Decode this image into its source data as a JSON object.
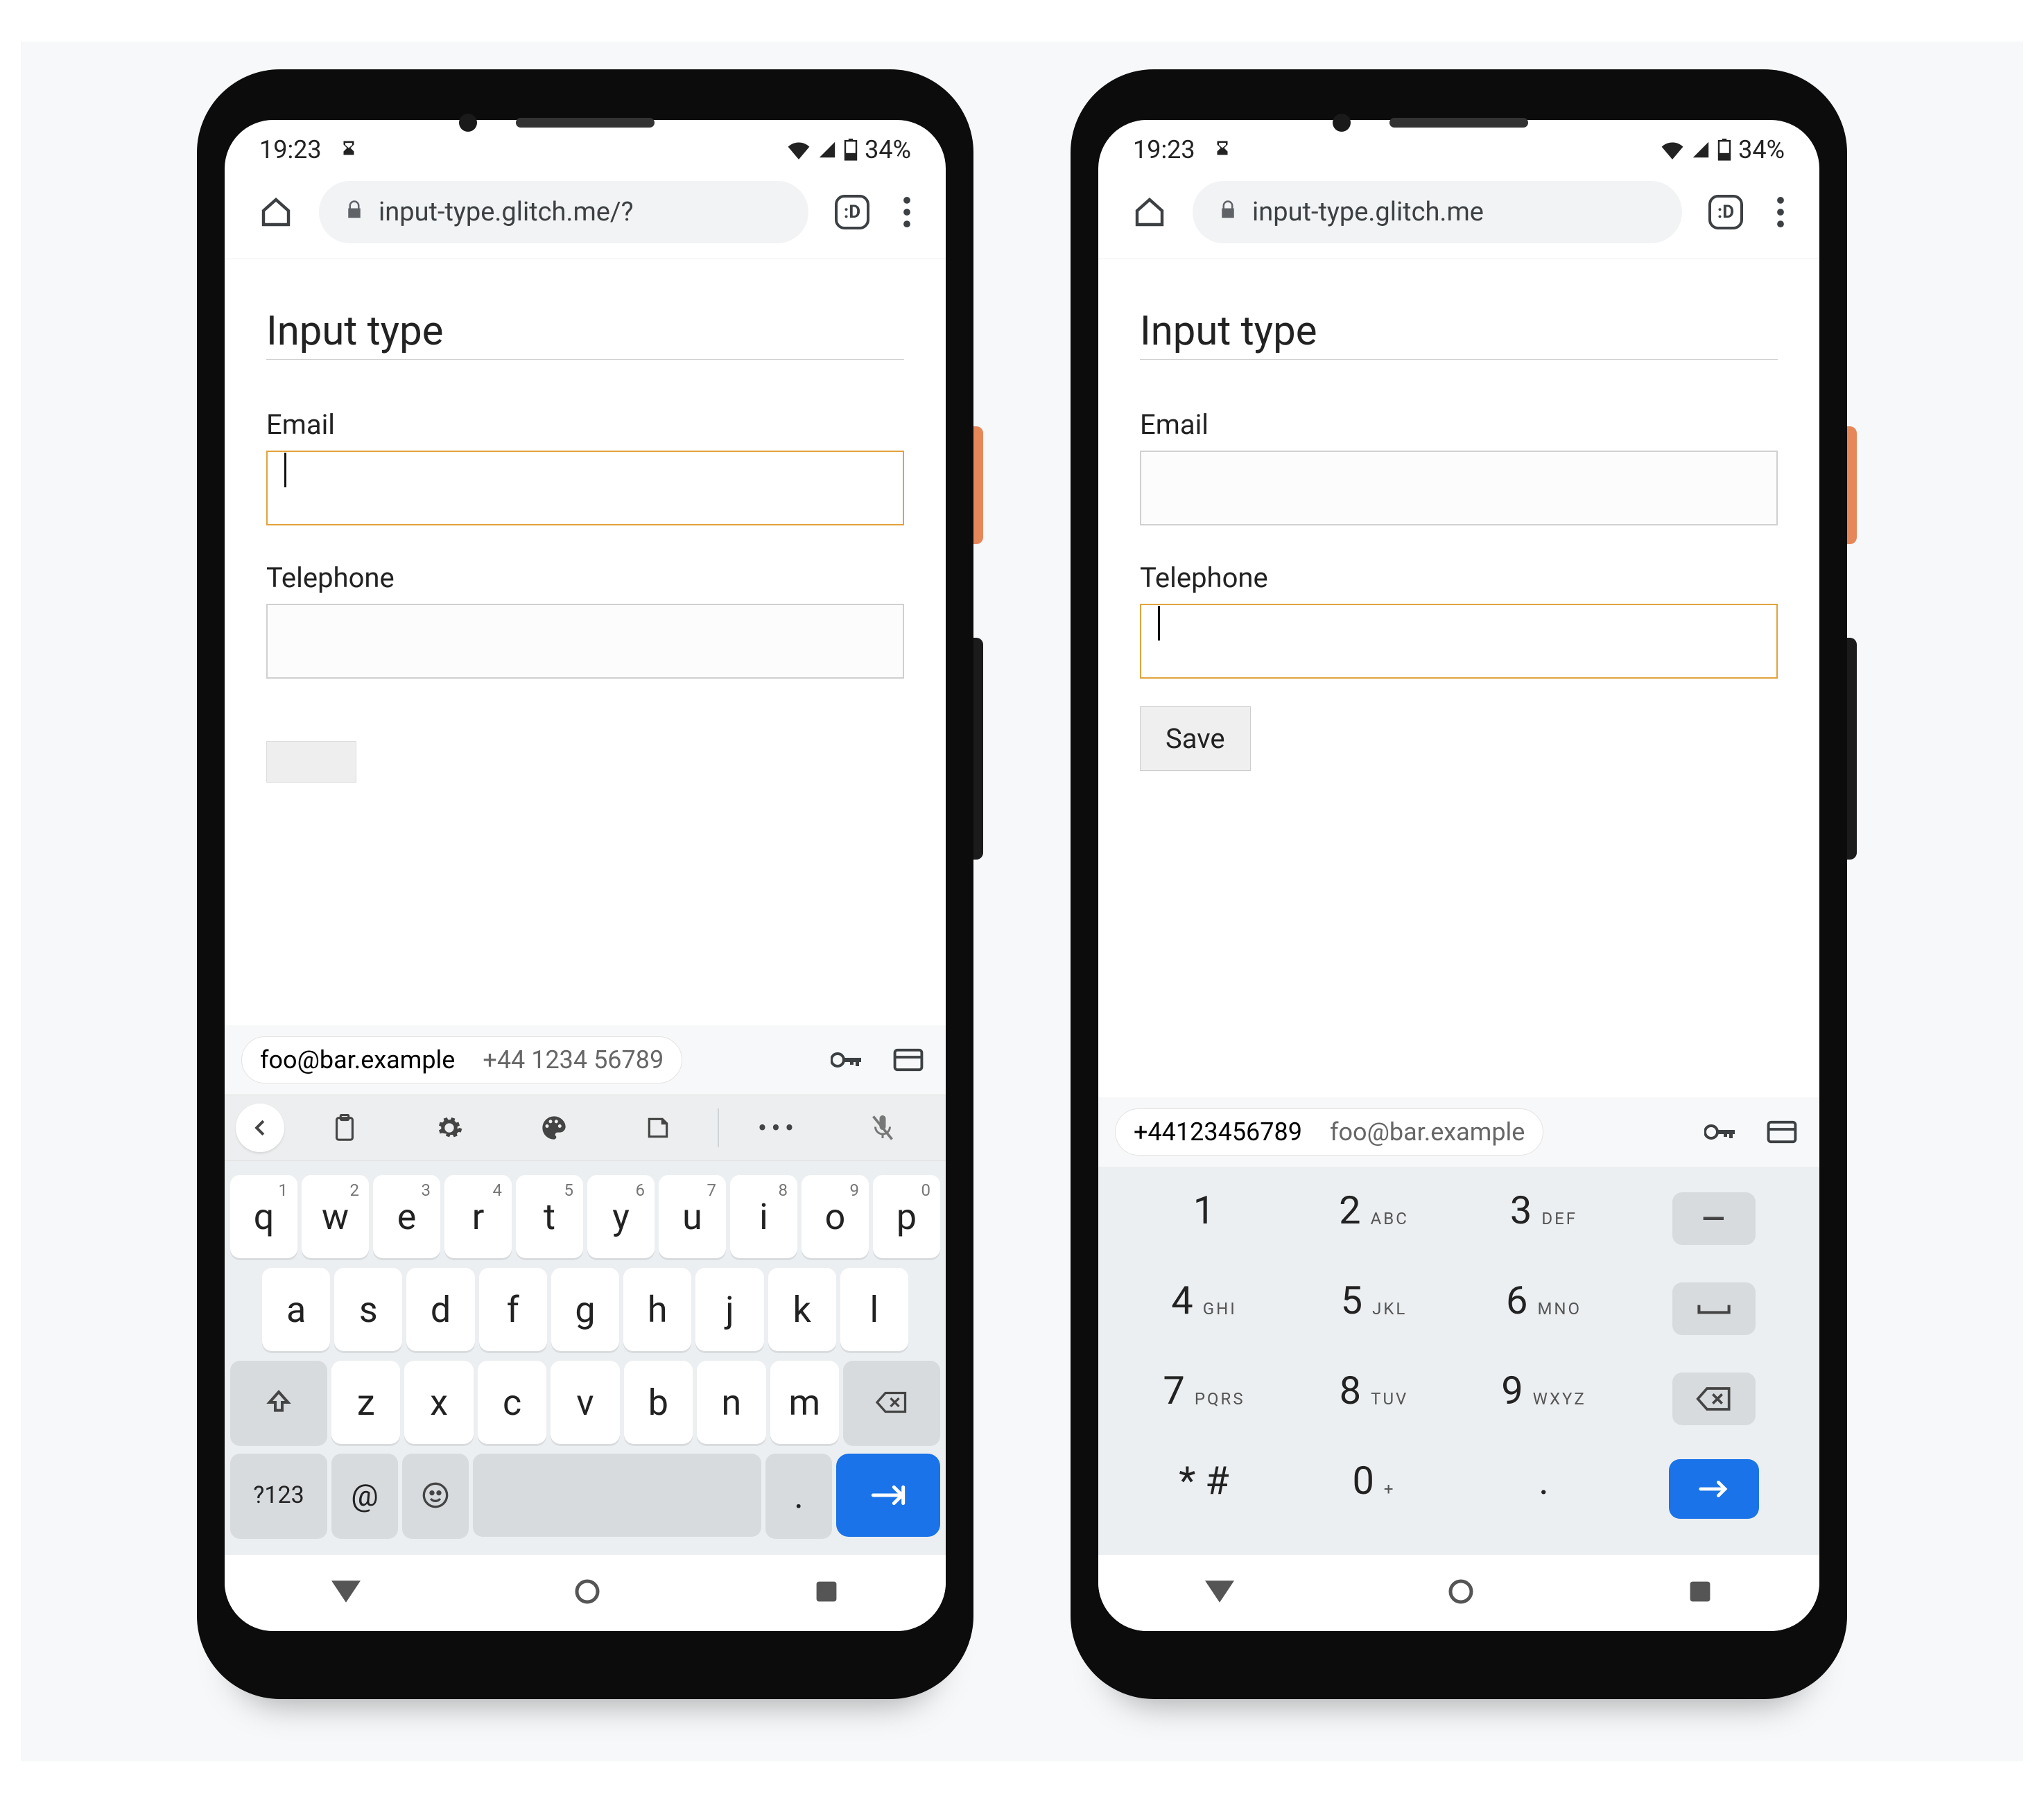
{
  "status": {
    "time": "19:23",
    "battery": "34%"
  },
  "chrome": {
    "url_left": "input-type.glitch.me/?",
    "url_right": "input-type.glitch.me",
    "tabs_label": ":D"
  },
  "form": {
    "heading": "Input type",
    "email_label": "Email",
    "tel_label": "Telephone",
    "save_label": "Save"
  },
  "autofill": {
    "email": "foo@bar.example",
    "phone": "+44 1234 56789",
    "phone_compact": "+44123456789"
  },
  "qwerty": {
    "row1": [
      {
        "k": "q",
        "n": "1"
      },
      {
        "k": "w",
        "n": "2"
      },
      {
        "k": "e",
        "n": "3"
      },
      {
        "k": "r",
        "n": "4"
      },
      {
        "k": "t",
        "n": "5"
      },
      {
        "k": "y",
        "n": "6"
      },
      {
        "k": "u",
        "n": "7"
      },
      {
        "k": "i",
        "n": "8"
      },
      {
        "k": "o",
        "n": "9"
      },
      {
        "k": "p",
        "n": "0"
      }
    ],
    "row2": [
      "a",
      "s",
      "d",
      "f",
      "g",
      "h",
      "j",
      "k",
      "l"
    ],
    "row3": [
      "z",
      "x",
      "c",
      "v",
      "b",
      "n",
      "m"
    ],
    "symkey": "?123",
    "atkey": "@",
    "dotkey": "."
  },
  "dialpad": {
    "rows": [
      [
        {
          "k": "1",
          "s": ""
        },
        {
          "k": "2",
          "s": "ABC"
        },
        {
          "k": "3",
          "s": "DEF"
        },
        {
          "k": "-",
          "s": "",
          "fn": true
        }
      ],
      [
        {
          "k": "4",
          "s": "GHI"
        },
        {
          "k": "5",
          "s": "JKL"
        },
        {
          "k": "6",
          "s": "MNO"
        },
        {
          "k": "⌴",
          "s": "",
          "fn": true,
          "icon": "space"
        }
      ],
      [
        {
          "k": "7",
          "s": "PQRS"
        },
        {
          "k": "8",
          "s": "TUV"
        },
        {
          "k": "9",
          "s": "WXYZ"
        },
        {
          "k": "⌫",
          "s": "",
          "fn": true,
          "icon": "bksp"
        }
      ],
      [
        {
          "k": "* #",
          "s": ""
        },
        {
          "k": "0",
          "s": "+"
        },
        {
          "k": ".",
          "s": ""
        },
        {
          "k": "→",
          "s": "",
          "fn": true,
          "icon": "enter"
        }
      ]
    ]
  },
  "chart_data": null
}
